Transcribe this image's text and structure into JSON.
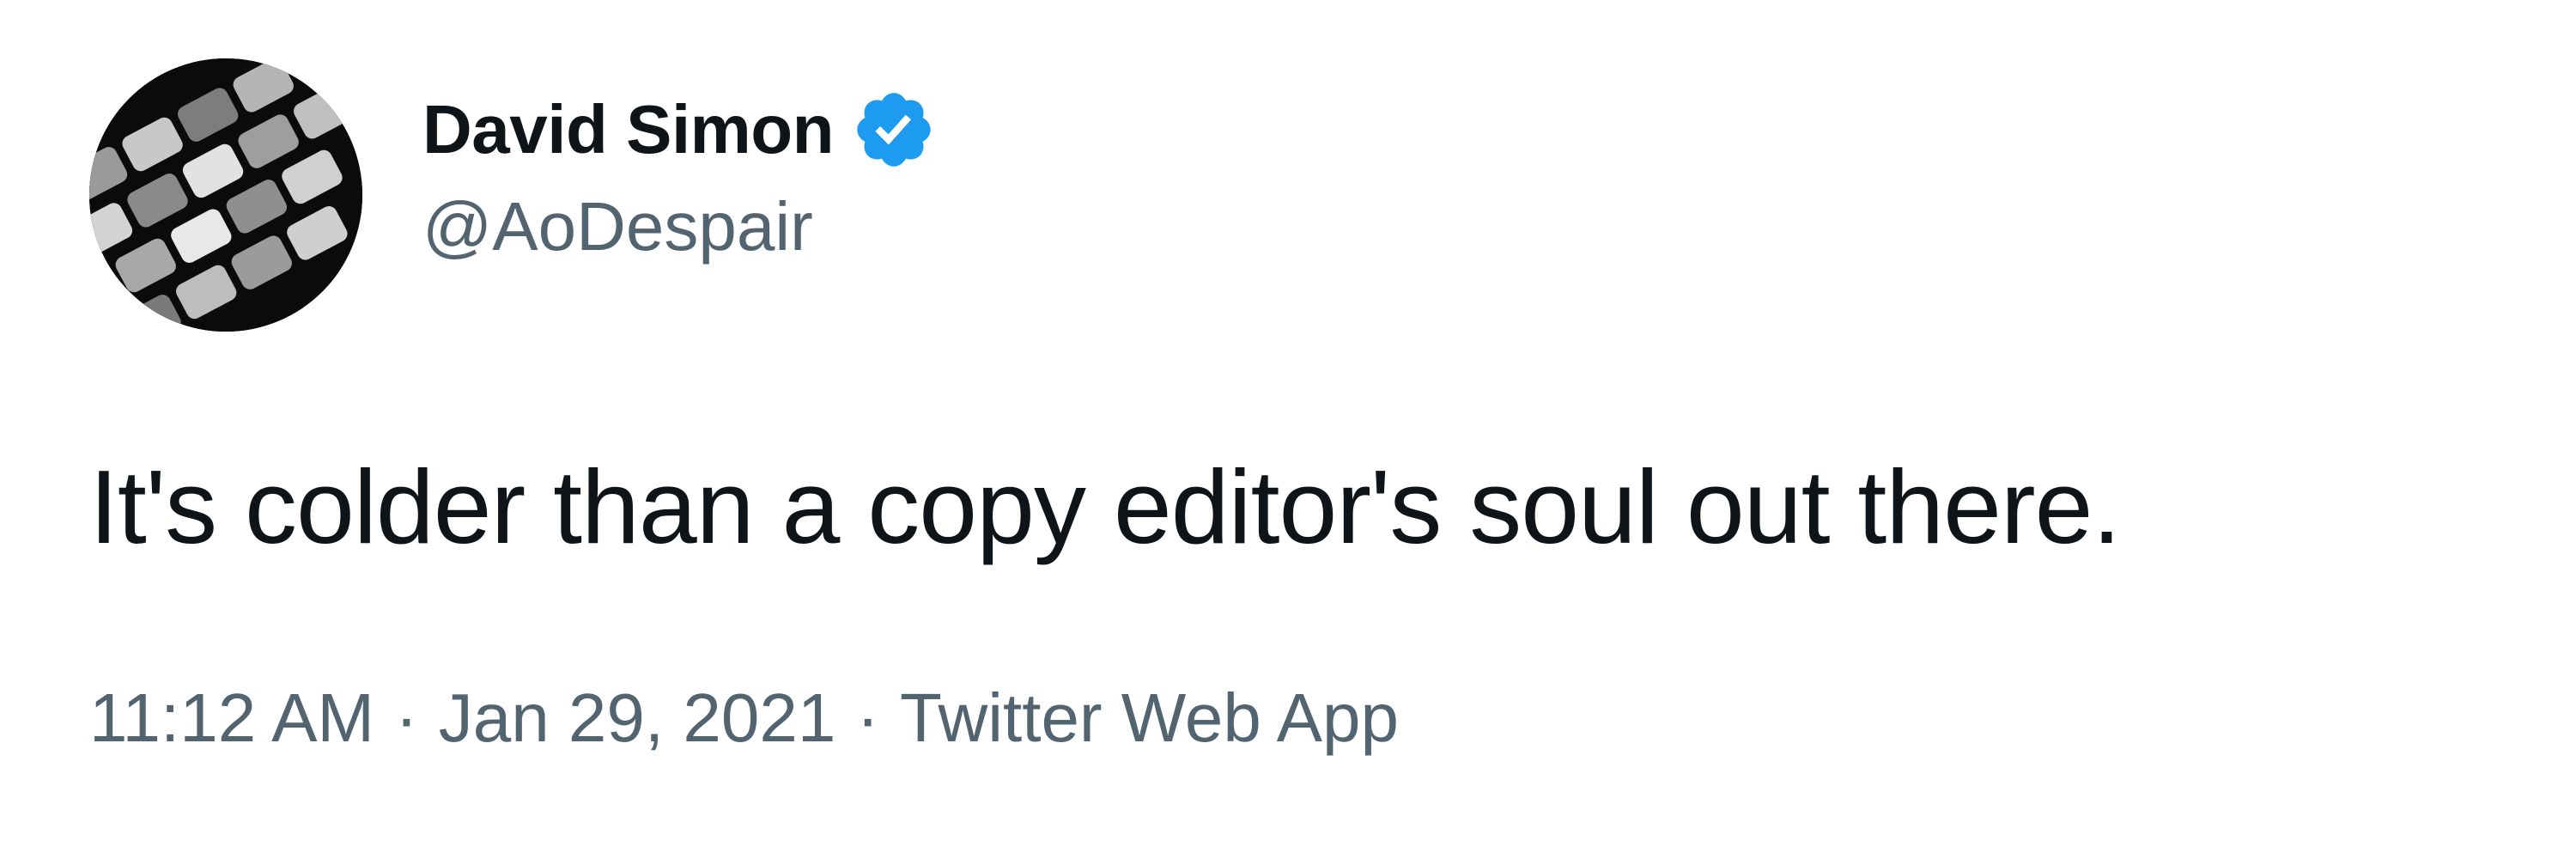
{
  "tweet": {
    "author": {
      "display_name": "David Simon",
      "handle": "@AoDespair",
      "verified": true,
      "avatar_icon": "typewriter-keys-avatar"
    },
    "text": "It's colder than a copy editor's soul out there.",
    "time": "11:12 AM",
    "separator": "·",
    "date": "Jan 29, 2021",
    "source": "Twitter Web App"
  },
  "colors": {
    "text_primary": "#0f1419",
    "text_secondary": "#536471",
    "verified_blue": "#1d9bf0",
    "background": "#ffffff"
  }
}
